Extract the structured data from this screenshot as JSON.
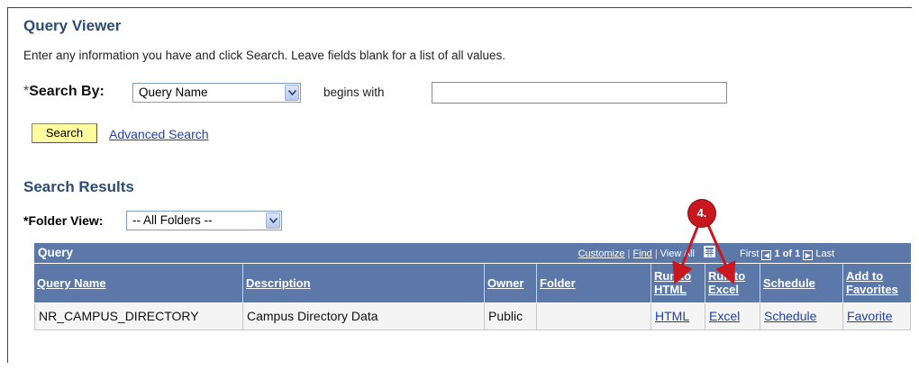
{
  "page": {
    "title": "Query Viewer",
    "instructions": "Enter any information you have and click Search. Leave fields blank for a list of all values."
  },
  "search": {
    "required_marker": "*",
    "label": "Search By:",
    "field_selected": "Query Name",
    "operator": "begins with",
    "value": "",
    "search_button": "Search",
    "advanced_link": "Advanced Search"
  },
  "results": {
    "title": "Search Results",
    "folder_label": "*Folder View:",
    "folder_selected": "-- All Folders --",
    "grid": {
      "title": "Query",
      "nav": {
        "customize": "Customize",
        "find": "Find",
        "view_all": "View All",
        "first": "First",
        "pages": "1 of 1",
        "last": "Last"
      },
      "columns": {
        "query_name": "Query Name",
        "description": "Description",
        "owner": "Owner",
        "folder": "Folder",
        "run_html": [
          "Run to",
          "HTML"
        ],
        "run_excel": [
          "Run to",
          "Excel"
        ],
        "schedule": "Schedule",
        "favorites": [
          "Add to",
          "Favorites"
        ]
      },
      "rows": [
        {
          "query_name": "NR_CAMPUS_DIRECTORY",
          "description": "Campus Directory Data",
          "owner": "Public",
          "folder": "",
          "run_html": "HTML",
          "run_excel": "Excel",
          "schedule": "Schedule",
          "favorite": "Favorite"
        }
      ]
    }
  },
  "annotation": {
    "label": "4.",
    "color": "#c8171f"
  },
  "colors": {
    "header_blue": "#5b78a8",
    "title_blue": "#2d4c74",
    "link_blue": "#1d3fb4",
    "button_yellow": "#fffb9e"
  }
}
